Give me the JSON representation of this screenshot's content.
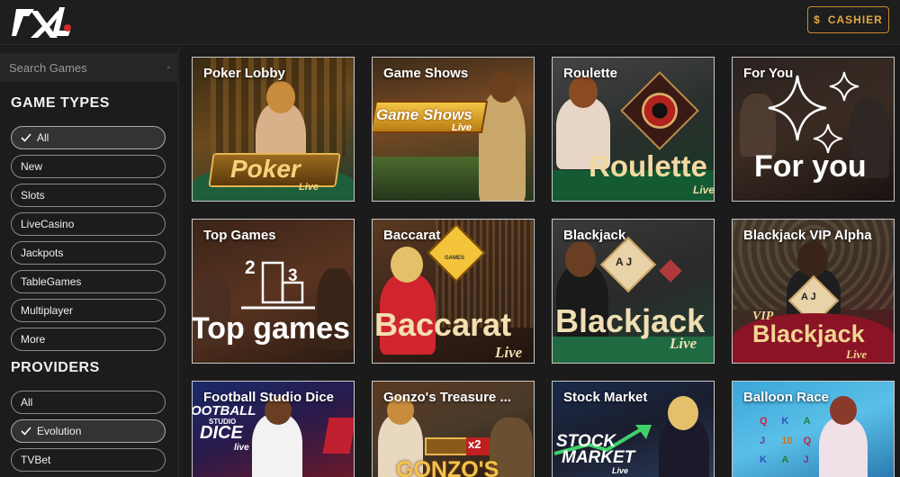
{
  "header": {
    "cashier_label": "CASHIER",
    "cashier_icon": "dollar-icon"
  },
  "search": {
    "placeholder": "Search Games"
  },
  "game_types": {
    "title": "GAME TYPES",
    "items": [
      {
        "label": "All",
        "selected": true
      },
      {
        "label": "New"
      },
      {
        "label": "Slots"
      },
      {
        "label": "LiveCasino"
      },
      {
        "label": "Jackpots"
      },
      {
        "label": "TableGames"
      },
      {
        "label": "Multiplayer"
      },
      {
        "label": "More"
      }
    ]
  },
  "providers": {
    "title": "PROVIDERS",
    "items": [
      {
        "label": "All"
      },
      {
        "label": "Evolution",
        "selected": true
      },
      {
        "label": "TVBet"
      }
    ]
  },
  "tiles": [
    {
      "title": "Poker Lobby",
      "art": "Poker",
      "art_sub": "Live"
    },
    {
      "title": "Game Shows",
      "art": "Game Shows",
      "art_sub": "Live"
    },
    {
      "title": "Roulette",
      "art": "Roulette",
      "art_sub": "Live"
    },
    {
      "title": "For You",
      "art": "For you"
    },
    {
      "title": "Top Games",
      "art": "Top games",
      "podium_2": "2",
      "podium_3": "3"
    },
    {
      "title": "Baccarat",
      "art": "Baccarat",
      "art_sub": "Live",
      "badge": "GAMES"
    },
    {
      "title": "Blackjack",
      "art": "Blackjack",
      "art_sub": "Live",
      "card": "A J"
    },
    {
      "title": "Blackjack VIP Alpha",
      "art_top": "VIP",
      "art": "Blackjack",
      "art_sub": "Live",
      "card": "A J"
    },
    {
      "title": "Football Studio Dice",
      "art_top": "OOTBALL",
      "art_mid": "STUDIO",
      "art": "DICE",
      "art_sub": "live"
    },
    {
      "title": "Gonzo's Treasure ...",
      "art": "GONZO'S",
      "badge": "x2"
    },
    {
      "title": "Stock Market",
      "art_top": "STOCK",
      "art": "MARKET",
      "art_sub": "Live"
    },
    {
      "title": "Balloon Race",
      "slots_row1": [
        "Q",
        "K",
        "A"
      ],
      "slots_row2": [
        "J",
        "10",
        "Q"
      ],
      "slots_row3": [
        "K",
        "A",
        "J"
      ]
    }
  ]
}
